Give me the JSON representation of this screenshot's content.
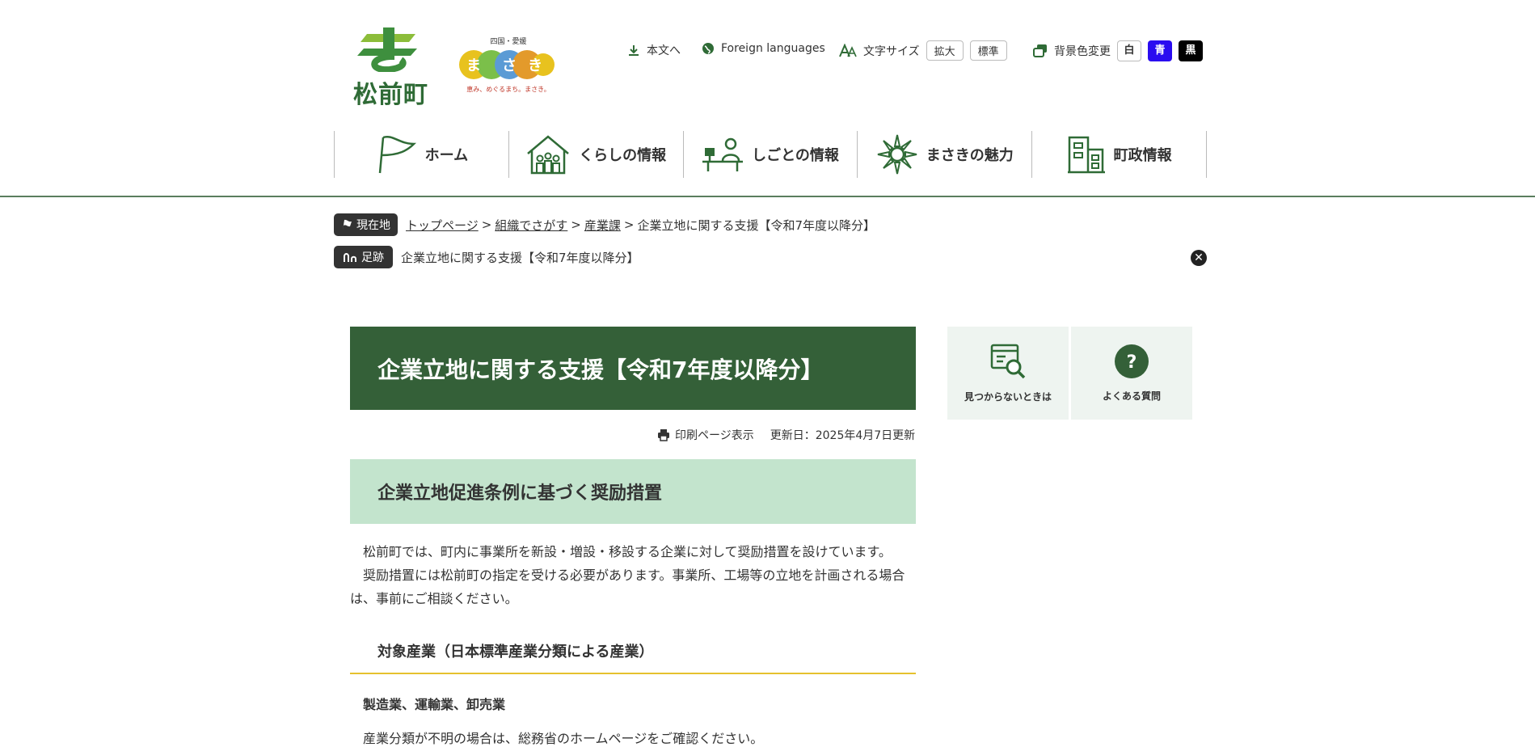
{
  "header": {
    "town_name": "松前町",
    "brand_caption_top": "四国・愛媛",
    "brand_slogan": "恵み、めぐるまち。まさき。",
    "utility": {
      "skip_label": "本文へ",
      "foreign_label": "Foreign languages",
      "font_size_label": "文字サイズ",
      "font_enlarge": "拡大",
      "font_standard": "標準",
      "bg_label": "背景色変更",
      "bg_white": "白",
      "bg_blue": "青",
      "bg_black": "黒"
    }
  },
  "nav": [
    {
      "label": "ホーム",
      "icon": "flag-icon"
    },
    {
      "label": "くらしの情報",
      "icon": "house-family-icon"
    },
    {
      "label": "しごとの情報",
      "icon": "worker-desk-icon"
    },
    {
      "label": "まさきの魅力",
      "icon": "sunflower-icon"
    },
    {
      "label": "町政情報",
      "icon": "building-icon"
    }
  ],
  "breadcrumb": {
    "current_badge": "現在地",
    "items": [
      "トップページ",
      "組織でさがす",
      "産業課"
    ],
    "sep": ">",
    "current": "企業立地に関する支援【令和7年度以降分】",
    "history_badge": "足跡",
    "history_item": "企業立地に関する支援【令和7年度以降分】"
  },
  "main": {
    "title": "企業立地に関する支援【令和7年度以降分】",
    "print_label": "印刷ページ表示",
    "updated": "更新日：2025年4月7日更新",
    "h2": "企業立地促進条例に基づく奨励措置",
    "para1": "松前町では、町内に事業所を新設・増設・移設する企業に対して奨励措置を設けています。",
    "para2": "奨励措置には松前町の指定を受ける必要があります。事業所、工場等の立地を計画される場合は、事前にご相談ください。",
    "h3": "対象産業（日本標準産業分類による産業）",
    "h4": "製造業、運輸業、卸売業",
    "cut_line": "産業分類が不明の場合は、総務省のホームページをご確認ください。"
  },
  "side": {
    "not_found": "見つからないときは",
    "faq": "よくある質問"
  },
  "colors": {
    "brand_green": "#346038",
    "light_green": "#c3e4cd",
    "accent_yellow": "#e6c12e",
    "bg_blue": "#2a0cf0"
  }
}
